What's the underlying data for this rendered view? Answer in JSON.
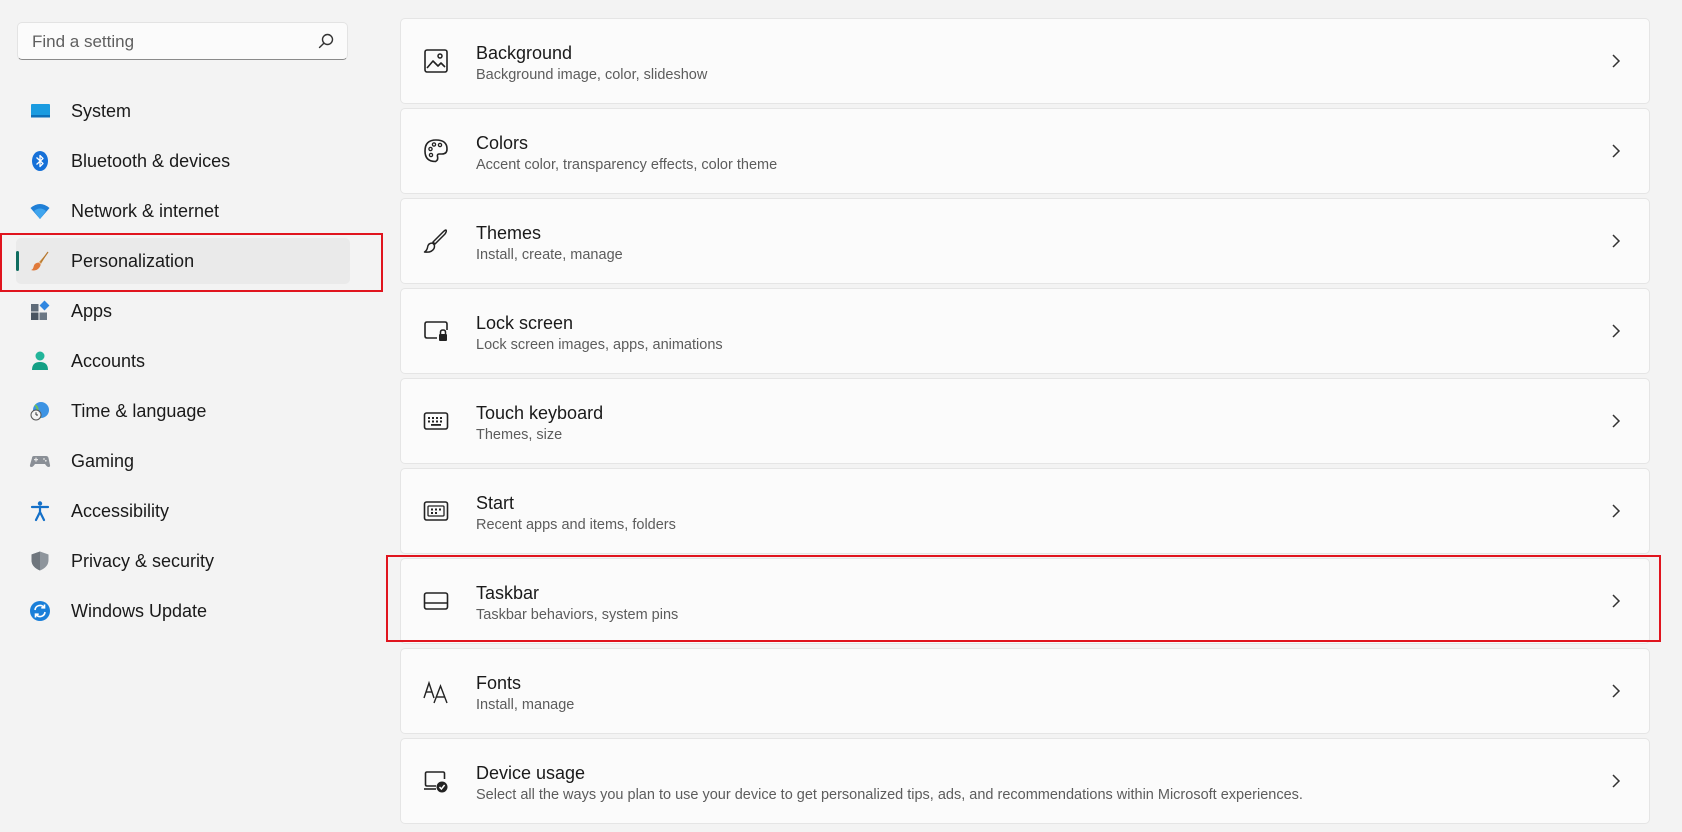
{
  "search": {
    "placeholder": "Find a setting"
  },
  "sidebar": {
    "items": [
      {
        "label": "System",
        "icon": "system-icon"
      },
      {
        "label": "Bluetooth & devices",
        "icon": "bluetooth-icon"
      },
      {
        "label": "Network & internet",
        "icon": "wifi-icon"
      },
      {
        "label": "Personalization",
        "icon": "paintbrush-icon",
        "selected": true
      },
      {
        "label": "Apps",
        "icon": "apps-icon"
      },
      {
        "label": "Accounts",
        "icon": "person-icon"
      },
      {
        "label": "Time & language",
        "icon": "globe-clock-icon"
      },
      {
        "label": "Gaming",
        "icon": "gamepad-icon"
      },
      {
        "label": "Accessibility",
        "icon": "accessibility-icon"
      },
      {
        "label": "Privacy & security",
        "icon": "shield-icon"
      },
      {
        "label": "Windows Update",
        "icon": "refresh-icon"
      }
    ]
  },
  "main": {
    "items": [
      {
        "title": "Background",
        "desc": "Background image, color, slideshow",
        "icon": "image-icon"
      },
      {
        "title": "Colors",
        "desc": "Accent color, transparency effects, color theme",
        "icon": "palette-icon"
      },
      {
        "title": "Themes",
        "desc": "Install, create, manage",
        "icon": "brush-icon"
      },
      {
        "title": "Lock screen",
        "desc": "Lock screen images, apps, animations",
        "icon": "lock-screen-icon"
      },
      {
        "title": "Touch keyboard",
        "desc": "Themes, size",
        "icon": "keyboard-icon"
      },
      {
        "title": "Start",
        "desc": "Recent apps and items, folders",
        "icon": "start-icon"
      },
      {
        "title": "Taskbar",
        "desc": "Taskbar behaviors, system pins",
        "icon": "taskbar-icon"
      },
      {
        "title": "Fonts",
        "desc": "Install, manage",
        "icon": "fonts-icon"
      },
      {
        "title": "Device usage",
        "desc": "Select all the ways you plan to use your device to get personalized tips, ads, and recommendations within Microsoft experiences.",
        "icon": "device-usage-icon"
      }
    ]
  },
  "colors": {
    "accent": "#0f6c5f",
    "highlight": "#e0141e",
    "background": "#f3f3f3",
    "card": "#fbfbfb"
  }
}
